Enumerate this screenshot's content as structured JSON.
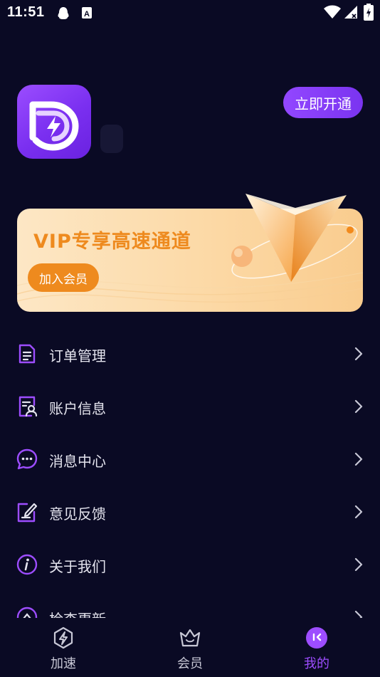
{
  "status_bar": {
    "time": "11:51",
    "icons": [
      "qq-icon",
      "a-notification-icon",
      "wifi-icon",
      "signal-icon",
      "battery-icon"
    ]
  },
  "header": {
    "app_logo_icon": "lightning-logo-icon",
    "activate_button": "立即开通"
  },
  "vip_banner": {
    "title": "VIP专享高速通道",
    "join_button": "加入会员",
    "colors": {
      "title": "#ee8a1e",
      "button": "#ee8a1e",
      "background": "#fde2b8"
    }
  },
  "menu": {
    "items": [
      {
        "label": "订单管理",
        "icon": "order-list-icon"
      },
      {
        "label": "账户信息",
        "icon": "account-info-icon"
      },
      {
        "label": "消息中心",
        "icon": "message-icon"
      },
      {
        "label": "意见反馈",
        "icon": "feedback-edit-icon"
      },
      {
        "label": "关于我们",
        "icon": "info-icon"
      },
      {
        "label": "检查更新",
        "icon": "update-icon"
      }
    ]
  },
  "bottom_nav": {
    "items": [
      {
        "label": "加速",
        "icon": "lightning-icon",
        "active": false
      },
      {
        "label": "会员",
        "icon": "crown-icon",
        "active": false
      },
      {
        "label": "我的",
        "icon": "profile-icon",
        "active": true
      }
    ],
    "active_color": "#9d4dff"
  },
  "colors": {
    "background": "#0a0a24",
    "accent": "#8a3ff5",
    "icon_stroke": "#9d4dff"
  }
}
